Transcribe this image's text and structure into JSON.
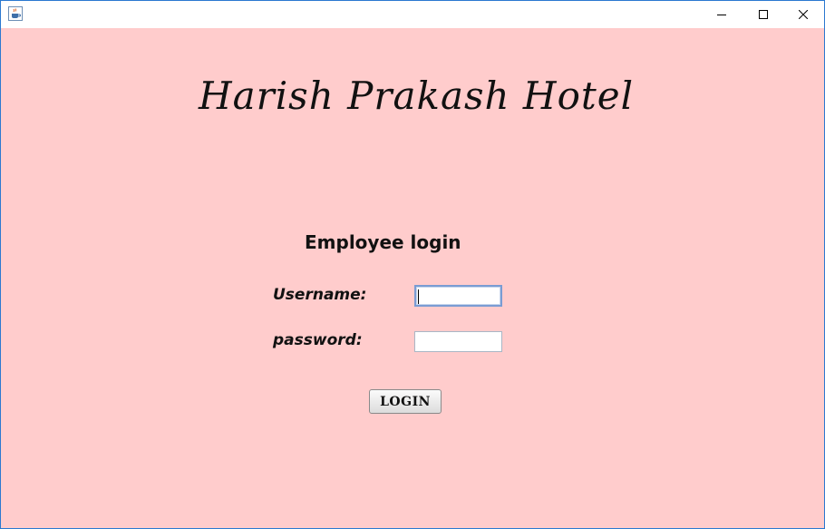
{
  "window": {
    "title": "",
    "icons": {
      "app": "java-coffee-cup-icon",
      "minimize": "minimize-icon",
      "maximize": "maximize-icon",
      "close": "close-icon"
    }
  },
  "colors": {
    "background": "#ffcccc",
    "window_border": "#2b79d0",
    "text": "#111111",
    "input_focus_border": "#7a9cd3"
  },
  "hotel": {
    "name": "Harish Prakash Hotel"
  },
  "login_form": {
    "title": "Employee login",
    "username_label": "Username:",
    "username_value": "",
    "password_label": "password:",
    "password_value": "",
    "login_button": "LOGIN"
  }
}
